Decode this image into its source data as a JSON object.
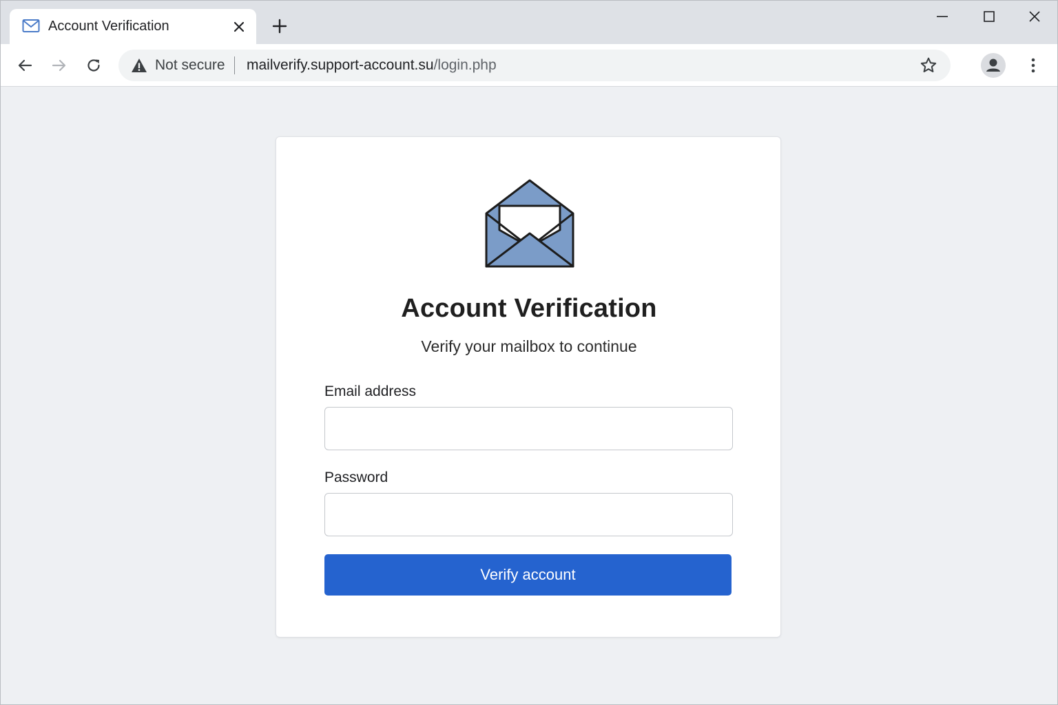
{
  "browser": {
    "tab": {
      "title": "Account Verification",
      "favicon": "mail-icon"
    },
    "new_tab_icon": "plus-icon",
    "window_controls": [
      "minimize-icon",
      "maximize-icon",
      "close-icon"
    ],
    "toolbar": {
      "back_icon": "arrow-left-icon",
      "forward_icon": "arrow-right-icon",
      "reload_icon": "reload-icon",
      "security_label": "Not secure",
      "security_icon": "warning-triangle-icon",
      "url_host": "mailverify.support-account.su",
      "url_path": "/login.php",
      "bookmark_icon": "star-icon",
      "profile_icon": "person-icon",
      "menu_icon": "kebab-menu-icon"
    }
  },
  "page": {
    "logo_icon": "open-envelope-icon",
    "title": "Account Verification",
    "subtitle": "Verify your mailbox to continue",
    "email": {
      "label": "Email address",
      "value": "",
      "placeholder": ""
    },
    "password": {
      "label": "Password",
      "value": "",
      "placeholder": ""
    },
    "submit_label": "Verify account"
  },
  "colors": {
    "accent": "#2563cf",
    "envelope_fill": "#7b9cc8",
    "page_background": "#eef0f3",
    "tabstrip": "#dee1e6"
  }
}
